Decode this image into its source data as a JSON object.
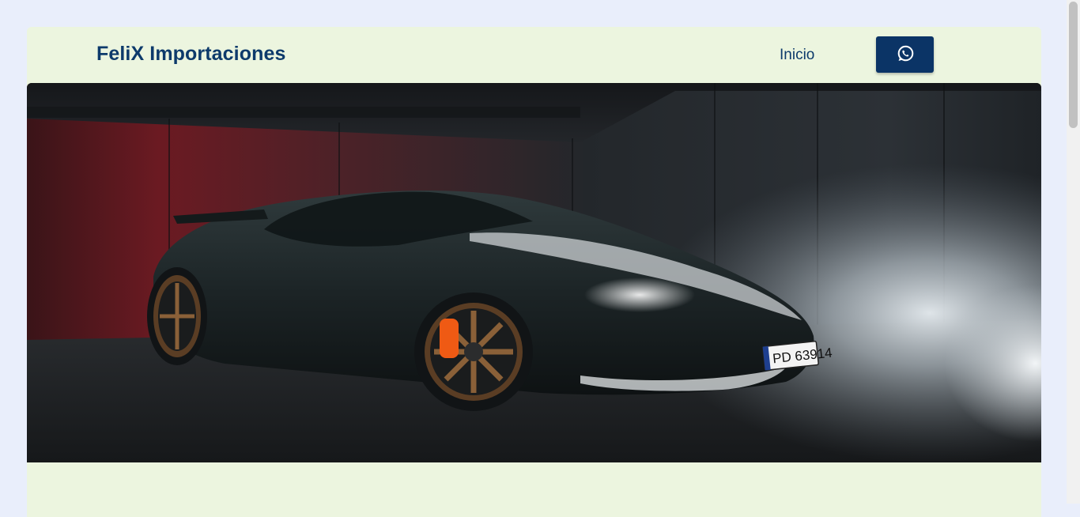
{
  "navbar": {
    "brand": "FeliX Importaciones",
    "links": [
      {
        "label": "Inicio"
      }
    ],
    "whatsapp_button": {
      "icon": "whatsapp-icon"
    }
  },
  "hero": {
    "image_plate_text": "PD 63914"
  },
  "colors": {
    "page_background": "#e9eefb",
    "container_background": "#ecf5df",
    "brand_text": "#0d3a6b",
    "button_background": "#0b3466"
  }
}
